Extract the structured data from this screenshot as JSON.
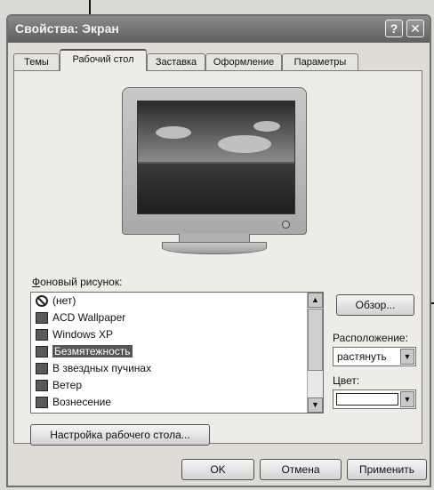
{
  "window": {
    "title": "Свойства: Экран",
    "help_glyph": "?",
    "close_glyph": "✕"
  },
  "tabs": [
    {
      "label": "Темы"
    },
    {
      "label": "Рабочий стол",
      "active": true
    },
    {
      "label": "Заставка"
    },
    {
      "label": "Оформление"
    },
    {
      "label": "Параметры"
    }
  ],
  "desktop": {
    "wallpaper_label_first": "Ф",
    "wallpaper_label_rest": "оновый рисунок:",
    "wallpapers": [
      {
        "label": "(нет)",
        "icon": "none-icon"
      },
      {
        "label": "ACD Wallpaper",
        "icon": "image-file-icon"
      },
      {
        "label": "Windows XP",
        "icon": "image-file-icon"
      },
      {
        "label": "Безмятежность",
        "icon": "image-file-icon",
        "selected": true
      },
      {
        "label": "В звездных пучинах",
        "icon": "image-file-icon"
      },
      {
        "label": "Ветер",
        "icon": "image-file-icon"
      },
      {
        "label": "Вознесение",
        "icon": "image-file-icon"
      }
    ],
    "browse_button": "Обзор...",
    "position_label": "Расположение:",
    "position_value": "растянуть",
    "color_label": "Цвет:",
    "customize_button": "Настройка рабочего стола..."
  },
  "buttons": {
    "ok": "OK",
    "cancel": "Отмена",
    "apply": "Применить"
  },
  "colors": {
    "titlebar": "#6e6e6e",
    "selection": "#555555",
    "face": "#eeece6"
  }
}
